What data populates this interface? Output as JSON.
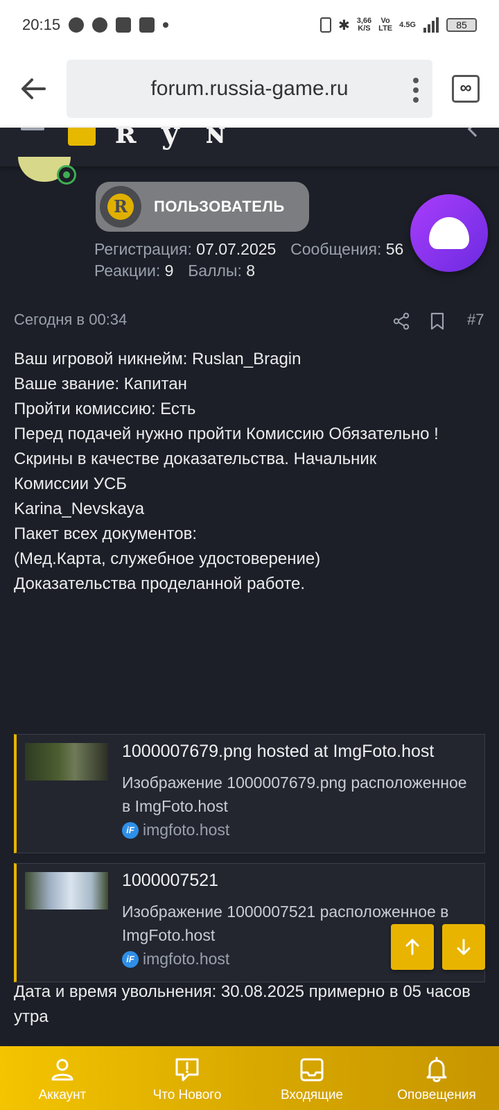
{
  "status_bar": {
    "time": "20:15",
    "network_speed": "3,66",
    "network_speed_unit": "K/S",
    "volte": "Vo",
    "lte": "LTE",
    "signal_label": "4.5G",
    "battery": "85"
  },
  "browser": {
    "url": "forum.russia-game.ru",
    "tabs_label": "∞"
  },
  "user": {
    "role": "ПОЛЬЗОВАТЕЛЬ",
    "role_icon_letter": "R",
    "registration_label": "Регистрация:",
    "registration_value": "07.07.2025",
    "messages_label": "Сообщения:",
    "messages_value": "56",
    "reactions_label": "Реакции:",
    "reactions_value": "9",
    "points_label": "Баллы:",
    "points_value": "8"
  },
  "post": {
    "date": "Сегодня в 00:34",
    "number": "#7",
    "lines": [
      "Ваш игровой никнейм: Ruslan_Bragin",
      "",
      "Ваше звание: Капитан",
      "",
      "Пройти комиссию: Есть",
      "",
      "Перед подачей нужно пройти Комиссию Обязательно !",
      "Скрины в качестве доказательства. Начальник",
      "Комиссии УСБ",
      "Karina_Nevskaya",
      "",
      "Пакет всех документов:",
      "(Мед.Карта, служебное удостоверение)",
      "",
      "Доказательства проделанной работе."
    ],
    "embeds": [
      {
        "title": "1000007679.png hosted at ImgFoto.host",
        "description": "Изображение 1000007679.png расположенное в ImgFoto.host",
        "source": "imgfoto.host"
      },
      {
        "title": "1000007521",
        "description": "Изображение 1000007521 расположенное в ImgFoto.host",
        "source": "imgfoto.host"
      }
    ],
    "after_text": "Дата и время увольнения: 30.08.2025 примерно в 05 часов утра"
  },
  "bottom_nav": {
    "account": "Аккаунт",
    "whats_new": "Что Нового",
    "inbox": "Входящие",
    "alerts": "Оповещения"
  },
  "colors": {
    "accent": "#e8b400",
    "background": "#1c1f27",
    "assistant": "#8a35f5"
  }
}
